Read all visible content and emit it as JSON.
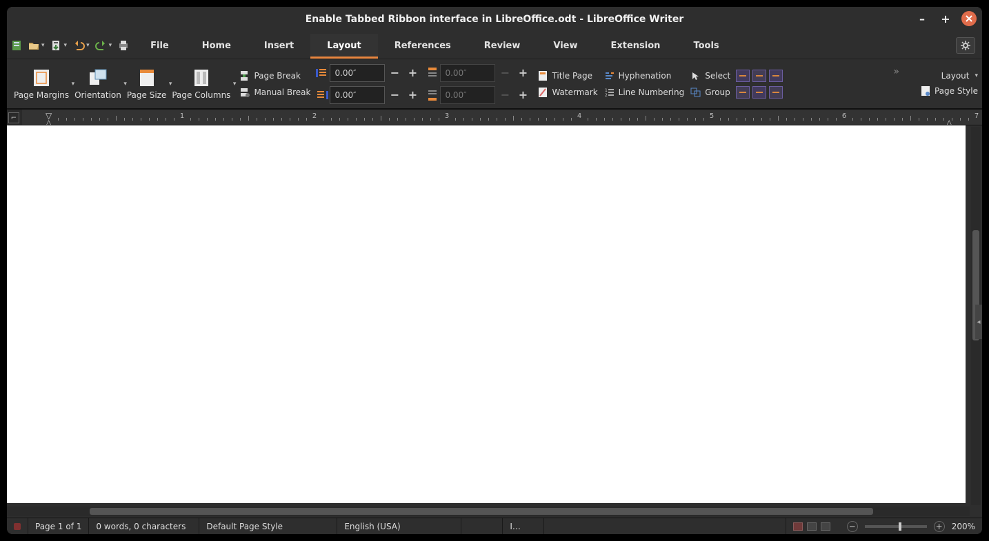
{
  "title": "Enable Tabbed Ribbon interface in LibreOffice.odt - LibreOffice Writer",
  "tabs": [
    "File",
    "Home",
    "Insert",
    "Layout",
    "References",
    "Review",
    "View",
    "Extension",
    "Tools"
  ],
  "active_tab": "Layout",
  "ribbon": {
    "big": {
      "page_margins": "Page Margins",
      "orientation": "Orientation",
      "page_size": "Page Size",
      "page_columns": "Page Columns"
    },
    "breaks": {
      "page_break": "Page Break",
      "manual_break": "Manual Break"
    },
    "indent": {
      "left": "0.00″",
      "right": "0.00″"
    },
    "spacing": {
      "above": "0.00″",
      "below": "0.00″"
    },
    "pagecol": {
      "title_page": "Title Page",
      "watermark": "Watermark",
      "hyphenation": "Hyphenation",
      "line_numbering": "Line Numbering"
    },
    "arrange": {
      "select": "Select",
      "group": "Group"
    },
    "right": {
      "layout": "Layout",
      "page_style": "Page Style"
    }
  },
  "ruler": {
    "numbers": [
      1,
      2,
      3,
      4,
      5,
      6
    ]
  },
  "status": {
    "page": "Page 1 of 1",
    "words": "0 words, 0 characters",
    "style": "Default Page Style",
    "lang": "English (USA)",
    "insert": "I…",
    "zoom": "200%"
  }
}
